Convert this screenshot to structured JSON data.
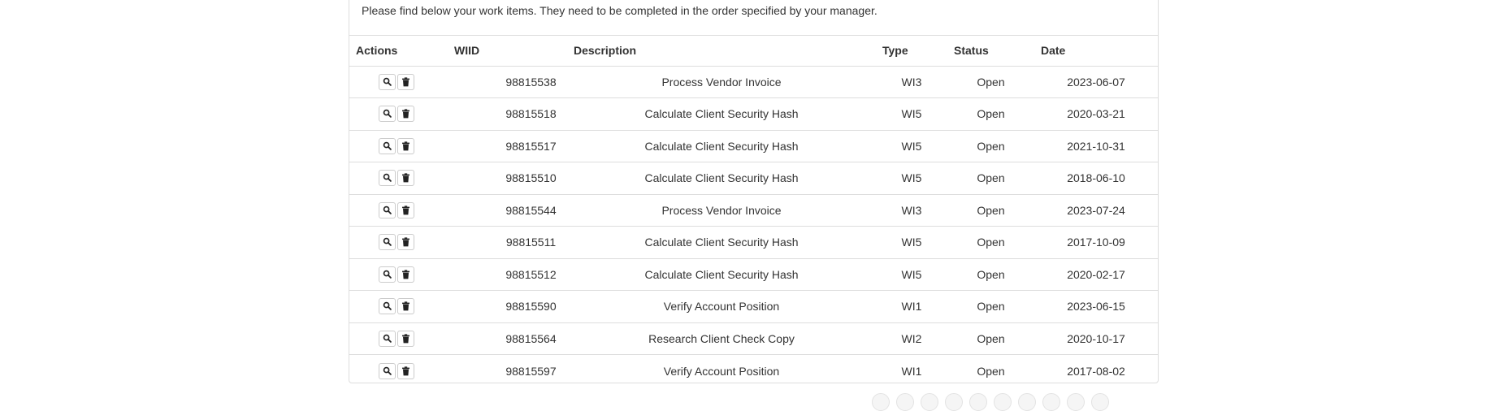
{
  "intro_text": "Please find below your work items. They need to be completed in the order specified by your manager.",
  "table": {
    "headers": {
      "actions": "Actions",
      "wiid": "WIID",
      "description": "Description",
      "type": "Type",
      "status": "Status",
      "date": "Date"
    },
    "rows": [
      {
        "wiid": "98815538",
        "description": "Process Vendor Invoice",
        "type": "WI3",
        "status": "Open",
        "date": "2023-06-07"
      },
      {
        "wiid": "98815518",
        "description": "Calculate Client Security Hash",
        "type": "WI5",
        "status": "Open",
        "date": "2020-03-21"
      },
      {
        "wiid": "98815517",
        "description": "Calculate Client Security Hash",
        "type": "WI5",
        "status": "Open",
        "date": "2021-10-31"
      },
      {
        "wiid": "98815510",
        "description": "Calculate Client Security Hash",
        "type": "WI5",
        "status": "Open",
        "date": "2018-06-10"
      },
      {
        "wiid": "98815544",
        "description": "Process Vendor Invoice",
        "type": "WI3",
        "status": "Open",
        "date": "2023-07-24"
      },
      {
        "wiid": "98815511",
        "description": "Calculate Client Security Hash",
        "type": "WI5",
        "status": "Open",
        "date": "2017-10-09"
      },
      {
        "wiid": "98815512",
        "description": "Calculate Client Security Hash",
        "type": "WI5",
        "status": "Open",
        "date": "2020-02-17"
      },
      {
        "wiid": "98815590",
        "description": "Verify Account Position",
        "type": "WI1",
        "status": "Open",
        "date": "2023-06-15"
      },
      {
        "wiid": "98815564",
        "description": "Research Client Check Copy",
        "type": "WI2",
        "status": "Open",
        "date": "2020-10-17"
      },
      {
        "wiid": "98815597",
        "description": "Verify Account Position",
        "type": "WI1",
        "status": "Open",
        "date": "2017-08-02"
      }
    ],
    "row_actions": [
      {
        "icon": "search-icon"
      },
      {
        "icon": "trash-icon"
      }
    ]
  },
  "colors": {
    "border": "#dddddd",
    "text": "#333333",
    "button_border": "#cccccc"
  }
}
